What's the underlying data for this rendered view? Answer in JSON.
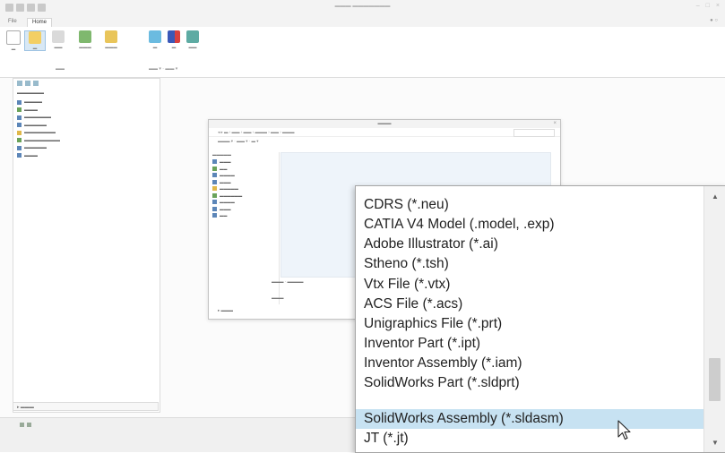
{
  "ribbon": {
    "tabs": [
      {
        "label": "File"
      },
      {
        "label": "Home"
      }
    ]
  },
  "file_type_list": {
    "items": [
      {
        "label": "CDRS (*.neu)"
      },
      {
        "label": "CATIA V4 Model (.model, .exp)"
      },
      {
        "label": "Adobe Illustrator (*.ai)"
      },
      {
        "label": "Stheno (*.tsh)"
      },
      {
        "label": "Vtx File (*.vtx)"
      },
      {
        "label": "ACS File (*.acs)"
      },
      {
        "label": "Unigraphics File (*.prt)"
      },
      {
        "label": "Inventor Part (*.ipt)"
      },
      {
        "label": "Inventor Assembly (*.iam)"
      },
      {
        "label": "SolidWorks Part (*.sldprt)"
      },
      {
        "label": "SolidWorks Assembly (*.sldasm)"
      },
      {
        "label": "JT (*.jt)"
      }
    ],
    "selected": "SolidWorks Assembly (*.sldasm)"
  },
  "icons": {
    "scroll_up": "scroll-up-arrow-icon",
    "scroll_down": "scroll-down-arrow-icon",
    "cursor": "mouse-pointer-icon"
  },
  "colors": {
    "highlight": "#c7e2f2",
    "list_border": "#a6a6a6"
  }
}
